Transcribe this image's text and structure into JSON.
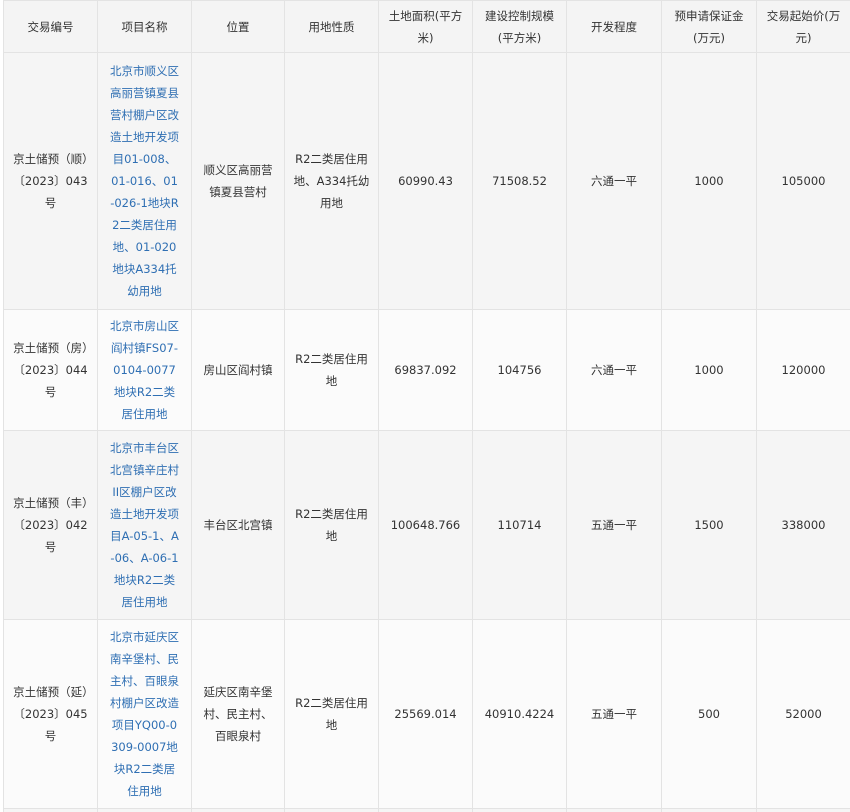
{
  "table": {
    "headers": [
      "交易编号",
      "项目名称",
      "位置",
      "用地性质",
      "土地面积(平方米)",
      "建设控制规模(平方米)",
      "开发程度",
      "预申请保证金(万元)",
      "交易起始价(万元)"
    ],
    "rows": [
      {
        "id": "京土储预（顺）〔2023〕043号",
        "project": "北京市顺义区高丽营镇夏县营村棚户区改造土地开发项目01-008、01-016、01-026-1地块R2二类居住用地、01-020地块A334托幼用地",
        "location": "顺义区高丽营镇夏县营村",
        "land_use": "R2二类居住用地、A334托幼用地",
        "area": "60990.43",
        "scale": "71508.52",
        "dev_level": "六通一平",
        "deposit": "1000",
        "start_price": "105000"
      },
      {
        "id": "京土储预（房）〔2023〕044号",
        "project": "北京市房山区阎村镇FS07-0104-0077地块R2二类居住用地",
        "location": "房山区阎村镇",
        "land_use": "R2二类居住用地",
        "area": "69837.092",
        "scale": "104756",
        "dev_level": "六通一平",
        "deposit": "1000",
        "start_price": "120000"
      },
      {
        "id": "京土储预（丰）〔2023〕042号",
        "project": "北京市丰台区北宫镇辛庄村II区棚户区改造土地开发项目A-05-1、A-06、A-06-1地块R2二类居住用地",
        "location": "丰台区北宫镇",
        "land_use": "R2二类居住用地",
        "area": "100648.766",
        "scale": "110714",
        "dev_level": "五通一平",
        "deposit": "1500",
        "start_price": "338000"
      },
      {
        "id": "京土储预（延）〔2023〕045号",
        "project": "北京市延庆区南辛堡村、民主村、百眼泉村棚户区改造项目YQ00-0309-0007地块R2二类居住用地",
        "location": "延庆区南辛堡村、民主村、百眼泉村",
        "land_use": "R2二类居住用地",
        "area": "25569.014",
        "scale": "40910.4224",
        "dev_level": "五通一平",
        "deposit": "500",
        "start_price": "52000"
      }
    ]
  }
}
